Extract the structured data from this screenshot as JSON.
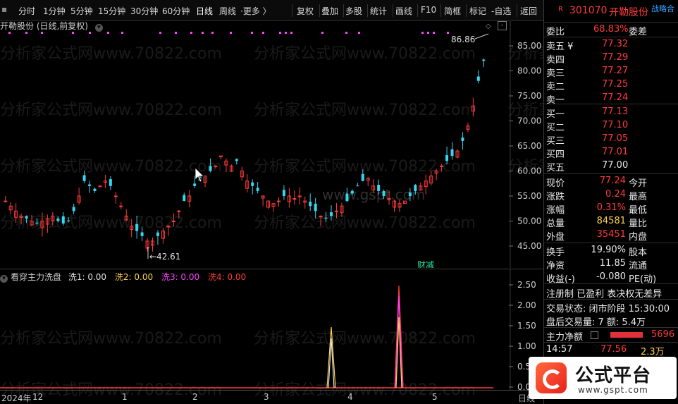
{
  "toolbar": {
    "periods": [
      "分时",
      "1分钟",
      "5分钟",
      "15分钟",
      "30分钟",
      "60分钟",
      "日线",
      "周线",
      "更多"
    ],
    "active_period": "日线",
    "more_arrow": "〉",
    "actions": [
      "复权",
      "叠加",
      "多股",
      "统计",
      "画线",
      "F10",
      "简框",
      "标记",
      "-自选",
      "返回"
    ]
  },
  "chart_title": "开勒股份 (日线,前复权)",
  "price_axis": [
    "85.00",
    "80.00",
    "75.00",
    "70.00",
    "65.00",
    "60.00",
    "55.00",
    "50.00",
    "45.00"
  ],
  "sub_axis": [
    "2.50",
    "2.00",
    "1.50",
    "1.00",
    "0.50",
    "0.00"
  ],
  "high_label": "86.86",
  "low_label": "42.61",
  "event_label": "财减",
  "watermark_main": "分析家公式网www.70822.com",
  "watermark_center": "www.gspt.com",
  "indicator": {
    "name": "看穿主力洗盘",
    "items": [
      {
        "label": "洗1: 0.00",
        "color": "#e0e0e0"
      },
      {
        "label": "洗2: 0.00",
        "color": "#ffd24c"
      },
      {
        "label": "洗3: 0.00",
        "color": "#ff40ff"
      },
      {
        "label": "洗4: 0.00",
        "color": "#ff3b3b"
      }
    ]
  },
  "date_axis": [
    "2024年",
    "12",
    "1",
    "2",
    "3",
    "4",
    "5"
  ],
  "date_axis_right": "日线",
  "stock": {
    "badge": "R",
    "code": "301070",
    "name": "开勒股份",
    "tag": "战略合"
  },
  "order_book": {
    "webi_label": "委比",
    "webi": "68.83%",
    "wecha_label": "委差",
    "asks": [
      {
        "label": "卖五 ¥",
        "price": "77.32"
      },
      {
        "label": "卖四",
        "price": "77.29"
      },
      {
        "label": "卖三",
        "price": "77.27"
      },
      {
        "label": "卖二",
        "price": "77.25"
      },
      {
        "label": "卖一",
        "price": "77.24"
      }
    ],
    "bids": [
      {
        "label": "买一",
        "price": "77.13"
      },
      {
        "label": "买二",
        "price": "77.10"
      },
      {
        "label": "买三",
        "price": "77.05"
      },
      {
        "label": "买四",
        "price": "77.01"
      },
      {
        "label": "买五",
        "price": "77.00"
      }
    ]
  },
  "quote": [
    {
      "l": "现价",
      "v": "77.24",
      "vc": "red",
      "r": "今开"
    },
    {
      "l": "涨跌",
      "v": "0.24",
      "vc": "red",
      "r": "最高"
    },
    {
      "l": "涨幅",
      "v": "0.31%",
      "vc": "red",
      "r": "最低"
    },
    {
      "l": "总量",
      "v": "84581",
      "vc": "yellow",
      "r": "量比"
    },
    {
      "l": "外盘",
      "v": "35451",
      "vc": "red",
      "r": "内盘"
    }
  ],
  "stats": [
    {
      "l": "换手",
      "v": "19.90%",
      "r": "股本"
    },
    {
      "l": "净资",
      "v": "11.85",
      "r": "流通"
    },
    {
      "l": "收益(-)",
      "v": "-0.080",
      "r": "PE(动)"
    }
  ],
  "info": {
    "tags": "注册制 已盈利 表决权无差异",
    "trade_state": "交易状态: 闭市阶段 15:30:00",
    "after_hours": "盘后交易量: 7  额: 5.4万"
  },
  "money_flow": {
    "label": "主力净额",
    "value": "5696"
  },
  "ticks": [
    {
      "time": "14:57",
      "price": "77.56",
      "vol": "2.3万"
    }
  ],
  "logo": {
    "text": "公式平台",
    "url": "www.gspt.com"
  }
}
